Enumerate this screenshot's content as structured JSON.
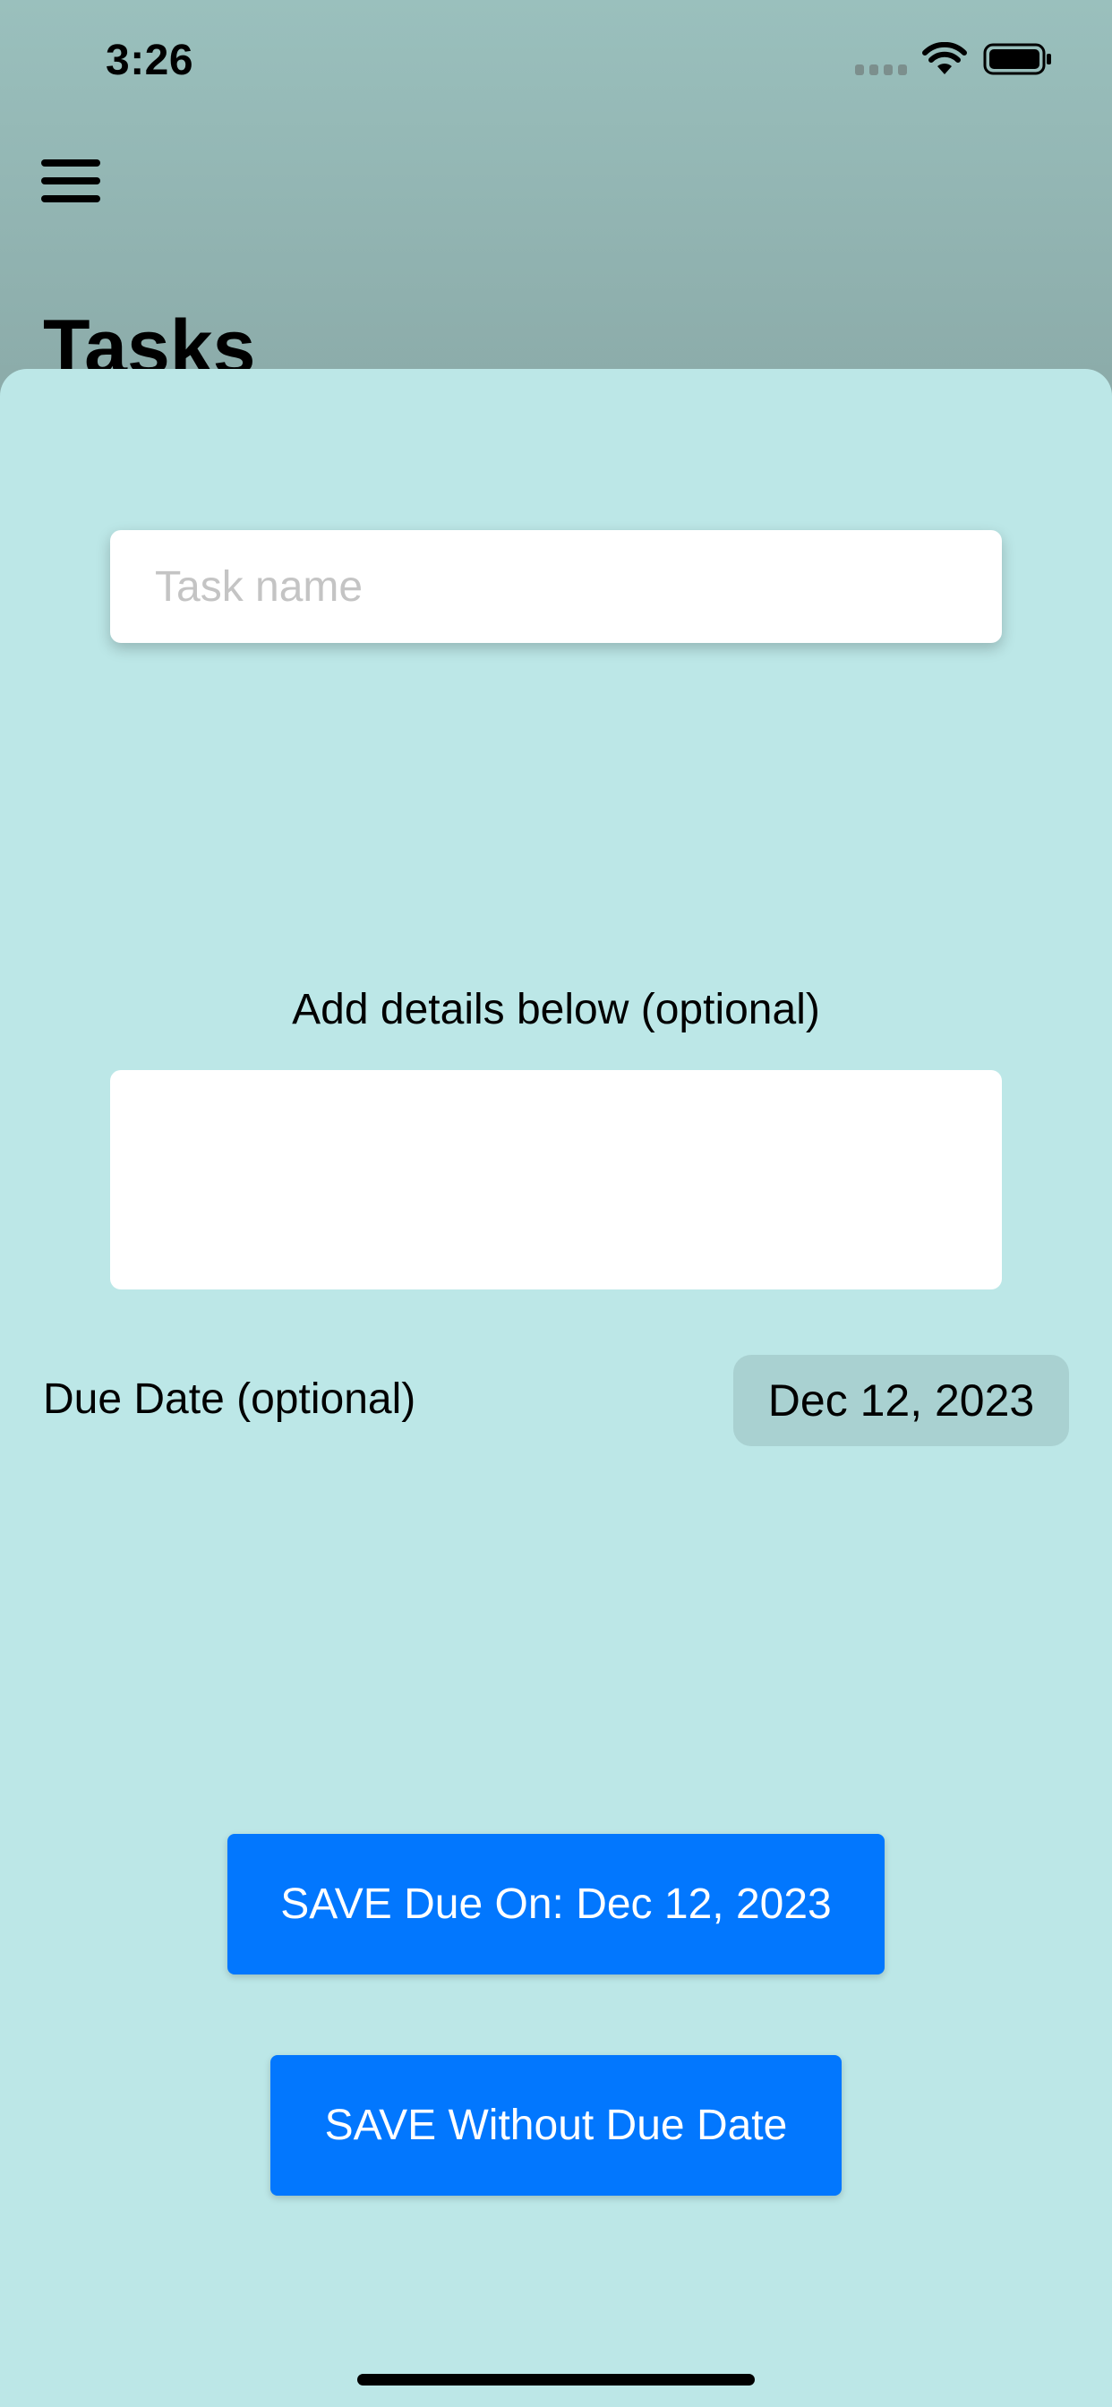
{
  "status_bar": {
    "time": "3:26",
    "icons": [
      "signal-icon",
      "wifi-icon",
      "battery-icon"
    ]
  },
  "nav": {
    "menu_icon": "hamburger-menu-icon",
    "title": "Tasks"
  },
  "form": {
    "task_name": {
      "placeholder": "Task name",
      "value": ""
    },
    "details": {
      "label": "Add details below (optional)",
      "value": ""
    },
    "due_date": {
      "label": "Due Date (optional)",
      "value": "Dec 12, 2023"
    }
  },
  "actions": {
    "save_with_due": "SAVE Due On: Dec 12, 2023",
    "save_without_due": "SAVE Without Due Date"
  },
  "colors": {
    "sheet_background": "#bce7e7",
    "button_blue": "#0277fe",
    "date_chip": "#a9d1d1",
    "dimmed_background": "#8cacaa"
  }
}
